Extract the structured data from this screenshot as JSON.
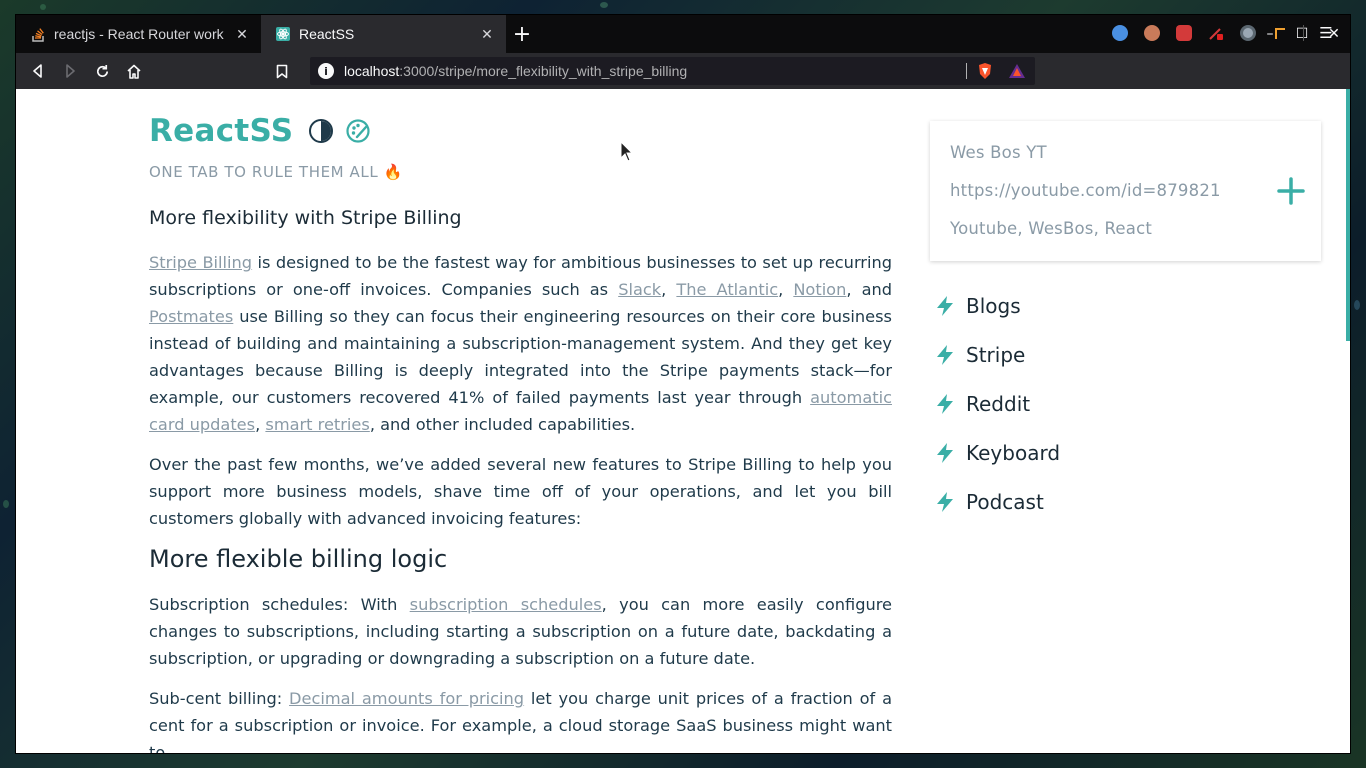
{
  "browser": {
    "tabs": [
      {
        "title": "reactjs - React Router work",
        "active": false,
        "favicon": "stackoverflow-icon"
      },
      {
        "title": "ReactSS",
        "active": true,
        "favicon": "react-icon"
      }
    ],
    "new_tab": "+",
    "window_controls": {
      "minimize": "–",
      "maximize": "☐",
      "close": "✕"
    },
    "url": {
      "host": "localhost",
      "rest": ":3000/stripe/more_flexibility_with_stripe_billing"
    },
    "extensions": [
      "brave-shield-icon",
      "brave-rewards-icon",
      "extension-1-icon",
      "extension-2-icon",
      "extension-3-icon",
      "extension-4-icon",
      "extension-5-icon",
      "extension-6-icon"
    ],
    "menu_label": "☰"
  },
  "page": {
    "brand": "ReactSS",
    "tagline": "ONE TAB TO RULE THEM ALL 🔥",
    "article": {
      "h3": "More flexibility with Stripe Billing",
      "p1": {
        "link_stripe_billing": "Stripe Billing",
        "t1": " is designed to be the fastest way for ambitious businesses to set up recurring subscriptions or one-off invoices. Companies such as ",
        "link_slack": "Slack",
        "sep1": ", ",
        "link_atlantic": "The Atlantic",
        "sep2": ", ",
        "link_notion": "Notion",
        "t2": ", and ",
        "link_postmates": "Postmates",
        "t3": " use Billing so they can focus their engineering resources on their core business instead of building and maintaining a subscription-management system. And they get key advantages because Billing is deeply integrated into the Stripe payments stack—for example, our customers recovered 41% of failed payments last year through ",
        "link_card_updates": "automatic card updates",
        "sep3": ", ",
        "link_smart_retries": "smart retries",
        "t4": ", and other included capabilities."
      },
      "p2": "Over the past few months, we’ve added several new features to Stripe Billing to help you support more business models, shave time off of your operations, and let you bill customers globally with advanced invoicing features:",
      "h2": "More flexible billing logic",
      "p3": {
        "t1": "Subscription schedules: With ",
        "link": "subscription schedules",
        "t2": ", you can more easily configure changes to subscriptions, including starting a subscription on a future date, backdating a subscription, or upgrading or downgrading a subscription on a future date."
      },
      "p4": {
        "t1": "Sub-cent billing: ",
        "link": "Decimal amounts for pricing",
        "t2": " let you charge unit prices of a fraction of a cent for a subscription or invoice. For example, a cloud storage SaaS business might want to"
      }
    },
    "form": {
      "name_placeholder": "Wes Bos YT",
      "url_placeholder": "https://youtube.com/id=879821",
      "tags_placeholder": "Youtube, WesBos, React"
    },
    "categories": [
      "Blogs",
      "Stripe",
      "Reddit",
      "Keyboard",
      "Podcast"
    ],
    "colors": {
      "accent": "#3aaea6",
      "text": "#1f3a4a",
      "muted": "#8a9aa6"
    }
  }
}
